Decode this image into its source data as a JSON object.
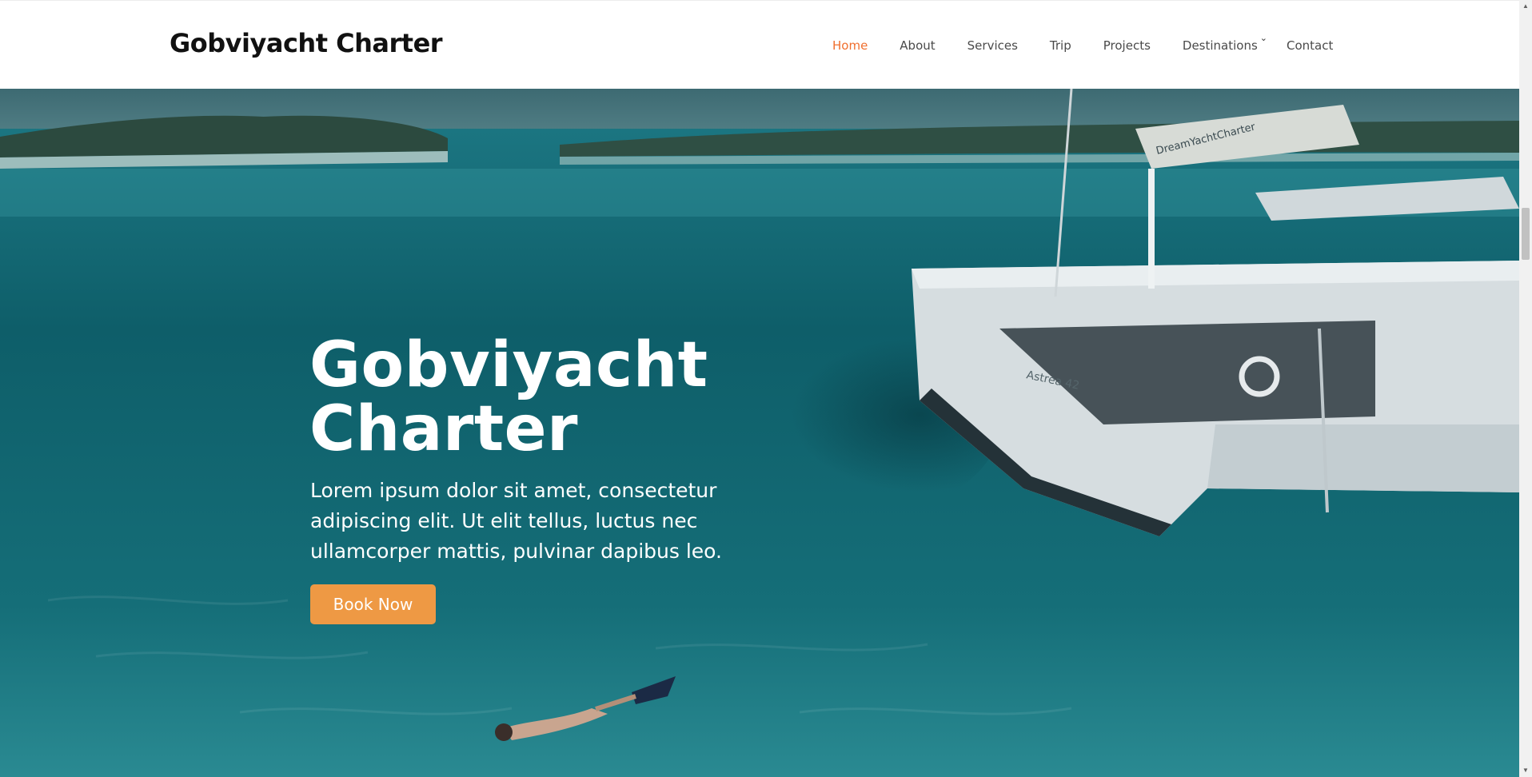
{
  "brand": {
    "name": "Gobviyacht Charter"
  },
  "nav": {
    "items": [
      "Home",
      "About",
      "Services",
      "Trip",
      "Projects",
      "Destinations",
      "Contact"
    ],
    "active_color": "#f06f2e",
    "dropdown_icon": "chevron-down-icon"
  },
  "hero": {
    "title": "Gobviyacht Charter",
    "text": "Lorem ipsum dolor sit amet, consectetur adipiscing elit. Ut elit tellus, luctus nec ullamcorper mattis, pulvinar dapibus leo.",
    "button_label": "Book Now",
    "button_color": "#ee9944",
    "yacht_name": "DreamYachtCharter",
    "hull_label": "Astrea 42"
  }
}
